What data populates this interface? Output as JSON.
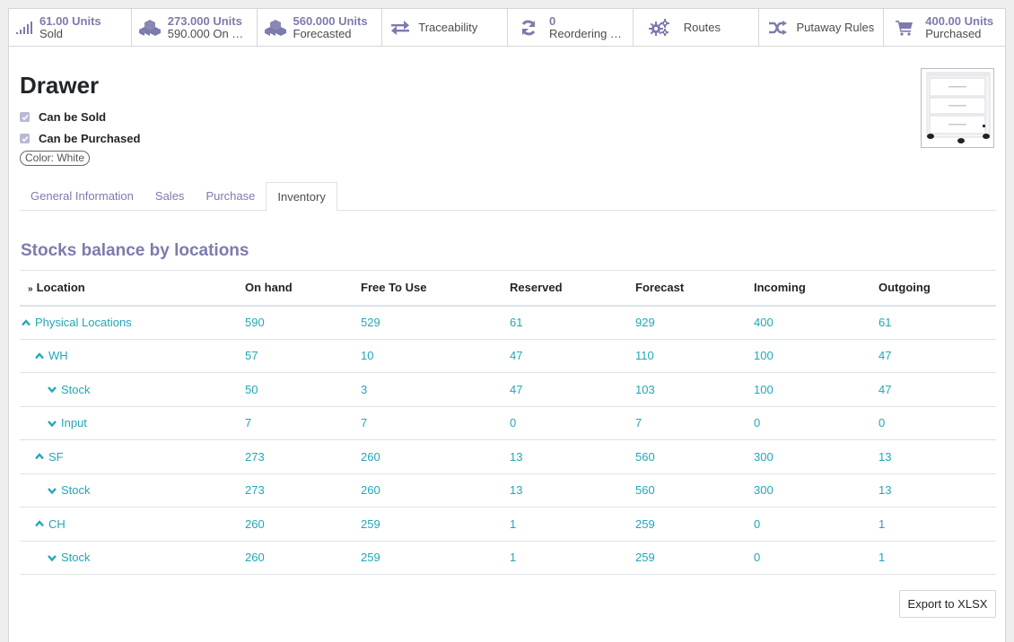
{
  "smart_buttons": [
    {
      "value": "61.00 Units",
      "label": "Sold",
      "icon": "bar-chart-icon"
    },
    {
      "value": "273.000 Units",
      "label": "590.000 On …",
      "icon": "cubes-icon"
    },
    {
      "value": "560.000 Units",
      "label": "Forecasted",
      "icon": "cubes-icon"
    },
    {
      "label": "Traceability",
      "icon": "exchange-arrows-icon"
    },
    {
      "value": "0",
      "label": "Reordering …",
      "icon": "refresh-icon"
    },
    {
      "label": "Routes",
      "icon": "gears-icon"
    },
    {
      "label": "Putaway Rules",
      "icon": "random-shuffle-icon"
    },
    {
      "value": "400.00 Units",
      "label": "Purchased",
      "icon": "shopping-cart-icon"
    }
  ],
  "product": {
    "name": "Drawer",
    "can_be_sold": "Can be Sold",
    "can_be_purchased": "Can be Purchased",
    "attribute_tag": "Color: White"
  },
  "tabs": [
    "General Information",
    "Sales",
    "Purchase",
    "Inventory"
  ],
  "active_tab": "Inventory",
  "section_title": "Stocks balance by locations",
  "table": {
    "columns": [
      "Location",
      "On hand",
      "Free To Use",
      "Reserved",
      "Forecast",
      "Incoming",
      "Outgoing"
    ],
    "rows": [
      {
        "location": "Physical Locations",
        "level": 0,
        "expanded": true,
        "values": [
          "590",
          "529",
          "61",
          "929",
          "400",
          "61"
        ]
      },
      {
        "location": "WH",
        "level": 1,
        "expanded": true,
        "values": [
          "57",
          "10",
          "47",
          "110",
          "100",
          "47"
        ]
      },
      {
        "location": "Stock",
        "level": 2,
        "expanded": false,
        "values": [
          "50",
          "3",
          "47",
          "103",
          "100",
          "47"
        ]
      },
      {
        "location": "Input",
        "level": 2,
        "expanded": false,
        "values": [
          "7",
          "7",
          "0",
          "7",
          "0",
          "0"
        ]
      },
      {
        "location": "SF",
        "level": 1,
        "expanded": true,
        "values": [
          "273",
          "260",
          "13",
          "560",
          "300",
          "13"
        ]
      },
      {
        "location": "Stock",
        "level": 2,
        "expanded": false,
        "values": [
          "273",
          "260",
          "13",
          "560",
          "300",
          "13"
        ]
      },
      {
        "location": "CH",
        "level": 1,
        "expanded": true,
        "values": [
          "260",
          "259",
          "1",
          "259",
          "0",
          "1"
        ]
      },
      {
        "location": "Stock",
        "level": 2,
        "expanded": false,
        "values": [
          "260",
          "259",
          "1",
          "259",
          "0",
          "1"
        ]
      }
    ]
  },
  "export_label": "Export to XLSX",
  "colors": {
    "accent": "#7c7bad",
    "link": "#21a7b6"
  }
}
